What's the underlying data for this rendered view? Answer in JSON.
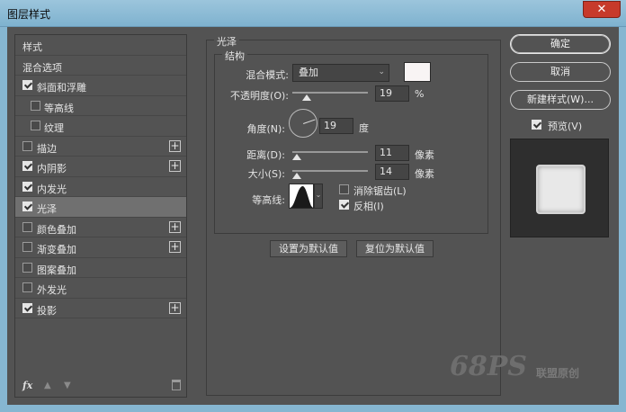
{
  "window": {
    "title": "图层样式",
    "close_glyph": "✕"
  },
  "styles_list": {
    "items": [
      {
        "label": "样式",
        "type": "header"
      },
      {
        "label": "混合选项",
        "type": "header"
      },
      {
        "label": "斜面和浮雕",
        "checked": true,
        "type": "item"
      },
      {
        "label": "等高线",
        "checked": false,
        "type": "sub"
      },
      {
        "label": "纹理",
        "checked": false,
        "type": "sub"
      },
      {
        "label": "描边",
        "checked": false,
        "type": "item",
        "plus": true
      },
      {
        "label": "内阴影",
        "checked": true,
        "type": "item",
        "plus": true
      },
      {
        "label": "内发光",
        "checked": true,
        "type": "item"
      },
      {
        "label": "光泽",
        "checked": true,
        "type": "item",
        "selected": true
      },
      {
        "label": "颜色叠加",
        "checked": false,
        "type": "item",
        "plus": true
      },
      {
        "label": "渐变叠加",
        "checked": false,
        "type": "item",
        "plus": true
      },
      {
        "label": "图案叠加",
        "checked": false,
        "type": "item"
      },
      {
        "label": "外发光",
        "checked": false,
        "type": "item"
      },
      {
        "label": "投影",
        "checked": true,
        "type": "item",
        "plus": true
      }
    ],
    "footer": {
      "fx": "fx",
      "up": "▲",
      "down": "▼"
    }
  },
  "satin": {
    "group_title": "光泽",
    "structure_title": "结构",
    "blend_mode": {
      "label": "混合模式:",
      "value": "叠加",
      "color": "#f8f4f4"
    },
    "opacity": {
      "label": "不透明度(O):",
      "value": "19",
      "unit": "%",
      "slider_percent": 19
    },
    "angle": {
      "label": "角度(N):",
      "value": "19",
      "unit": "度"
    },
    "distance": {
      "label": "距离(D):",
      "value": "11",
      "unit": "像素"
    },
    "size": {
      "label": "大小(S):",
      "value": "14",
      "unit": "像素"
    },
    "contour": {
      "label": "等高线:"
    },
    "anti_aliased": {
      "label": "消除锯齿(L)",
      "checked": false
    },
    "invert": {
      "label": "反相(I)",
      "checked": true
    },
    "make_default": "设置为默认值",
    "reset_default": "复位为默认值"
  },
  "actions": {
    "ok": "确定",
    "cancel": "取消",
    "new_style": "新建样式(W)...",
    "preview_label": "预览(V)",
    "preview_checked": true
  },
  "watermark": {
    "big": "68PS",
    "small": "联盟原创"
  }
}
